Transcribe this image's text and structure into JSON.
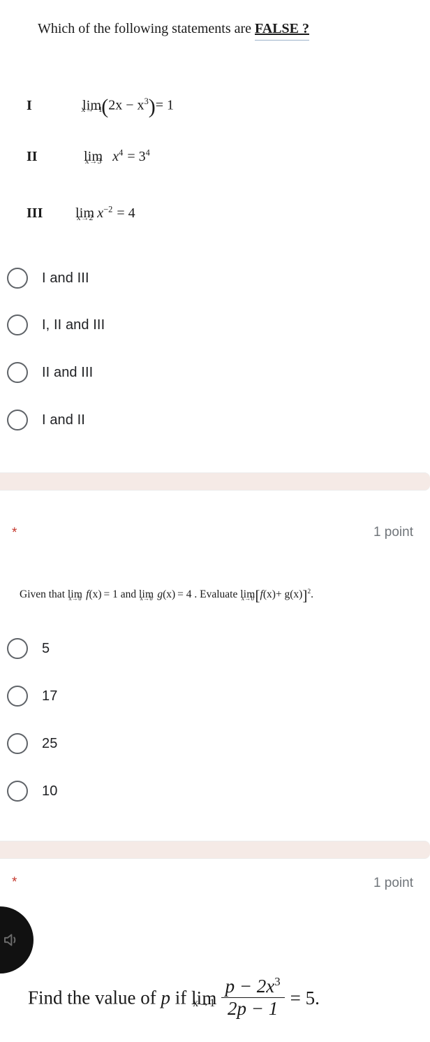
{
  "question1": {
    "prompt_prefix": "Which of the following statements are ",
    "prompt_emphasis": "FALSE ?",
    "statements": [
      {
        "roman": "I",
        "expr_text": "lim (x→-1) (2x - x^3) = 1",
        "lim_op": "lim",
        "lim_sub": "x→−1",
        "body_open": "(",
        "body": "2x − x",
        "body_exp": "3",
        "body_close": ")",
        "rhs": "= 1"
      },
      {
        "roman": "II",
        "expr_text": "lim (x→3) x^4 = 3^4",
        "lim_op": "lim",
        "lim_sub": "x→3",
        "base": "x",
        "base_exp": "4",
        "eq": "=",
        "rhs_base": "3",
        "rhs_exp": "4"
      },
      {
        "roman": "III",
        "expr_text": "lim (x→2) x^-2 = 4",
        "lim_op": "lim",
        "lim_sub": "x→2",
        "base": "x",
        "base_exp": "−2",
        "eq": "=",
        "rhs_base": "4"
      }
    ],
    "options": [
      {
        "label": "I and III"
      },
      {
        "label": "I, II and III"
      },
      {
        "label": "II and III"
      },
      {
        "label": "I and II"
      }
    ]
  },
  "question2": {
    "required_marker": "*",
    "points": "1 point",
    "prompt": {
      "t1": "Given that ",
      "lim1_op": "lim",
      "lim1_sub": "x→b",
      "t2": "f",
      "t3": "(x)",
      "t4": "= 1 and ",
      "lim2_op": "lim",
      "lim2_sub": "x→b",
      "t5": "g",
      "t6": "(x)",
      "t7": "= 4 . Evaluate ",
      "lim3_op": "lim",
      "lim3_sub": "x→b",
      "t8": "[",
      "t9": "f",
      "t10": "(x)",
      "t11": "+ g",
      "t12": "(x)",
      "t13": "]",
      "t13_exp": "2",
      "t14": ".",
      "plain": "Given that lim x→b f(x) = 1 and lim x→b g(x) = 4 . Evaluate lim x→b [ f(x) + g(x) ]^2 ."
    },
    "options": [
      {
        "label": "5"
      },
      {
        "label": "17"
      },
      {
        "label": "25"
      },
      {
        "label": "10"
      }
    ]
  },
  "question3": {
    "required_marker": "*",
    "points": "1 point",
    "audio_icon": "speaker-icon",
    "prompt": {
      "t1": "Find the value of ",
      "var": "p",
      "t2": " if ",
      "lim_op": "lim",
      "lim_sub": "x→1",
      "frac_num": "p − 2x",
      "frac_num_exp": "3",
      "frac_den": "2p − 1",
      "t3": "= 5.",
      "plain": "Find the value of p if lim x→1 (p − 2x^3)/(2p − 1) = 5."
    }
  },
  "colors": {
    "separator_band": "#f5eae6",
    "required_star": "#c5372c",
    "points_text": "#70757a",
    "radio_stroke": "#5f6368",
    "option_text": "#202124",
    "emphasis_rule": "#9db3c9",
    "audio_bubble": "#111111"
  }
}
